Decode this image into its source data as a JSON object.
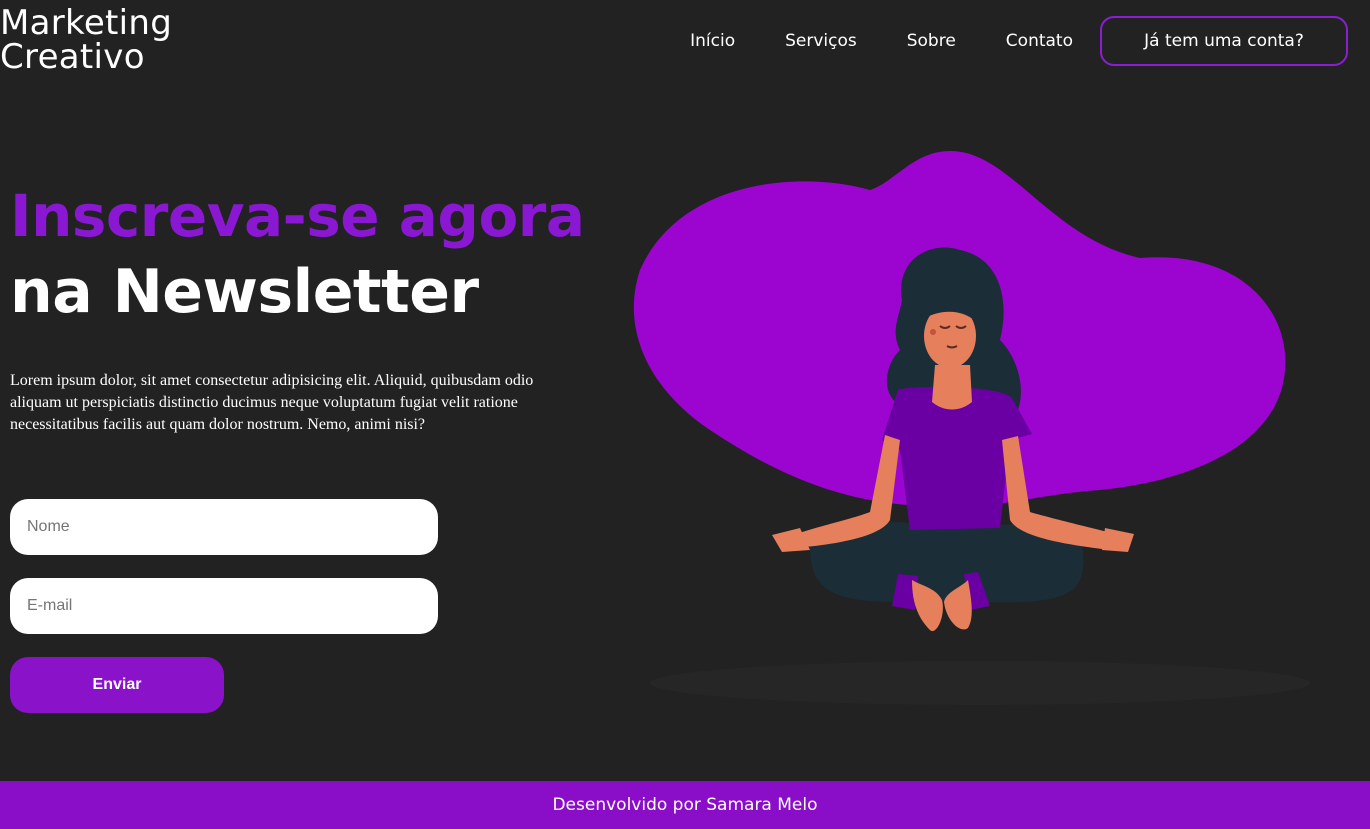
{
  "header": {
    "logo_line1": "Marketing",
    "logo_line2": "Creativo",
    "nav": {
      "inicio": "Início",
      "servicos": "Serviços",
      "sobre": "Sobre",
      "contato": "Contato"
    },
    "account_button": "Já tem uma conta?"
  },
  "hero": {
    "headline_line1": "Inscreva-se agora",
    "headline_line2": "na Newsletter",
    "description": "Lorem ipsum dolor, sit amet consectetur adipisicing elit. Aliquid, quibusdam odio aliquam ut perspiciatis distinctio ducimus neque voluptatum fugiat velit ratione necessitatibus facilis aut quam dolor nostrum. Nemo, animi nisi?"
  },
  "form": {
    "name_placeholder": "Nome",
    "email_placeholder": "E-mail",
    "submit_label": "Enviar"
  },
  "footer": {
    "text": "Desenvolvido por Samara Melo"
  },
  "colors": {
    "background": "#222222",
    "accent": "#8a12c9",
    "blob": "#9b05cf",
    "footer": "#8a0ec8"
  },
  "icons": {
    "illustration": "woman-meditating-illustration"
  }
}
